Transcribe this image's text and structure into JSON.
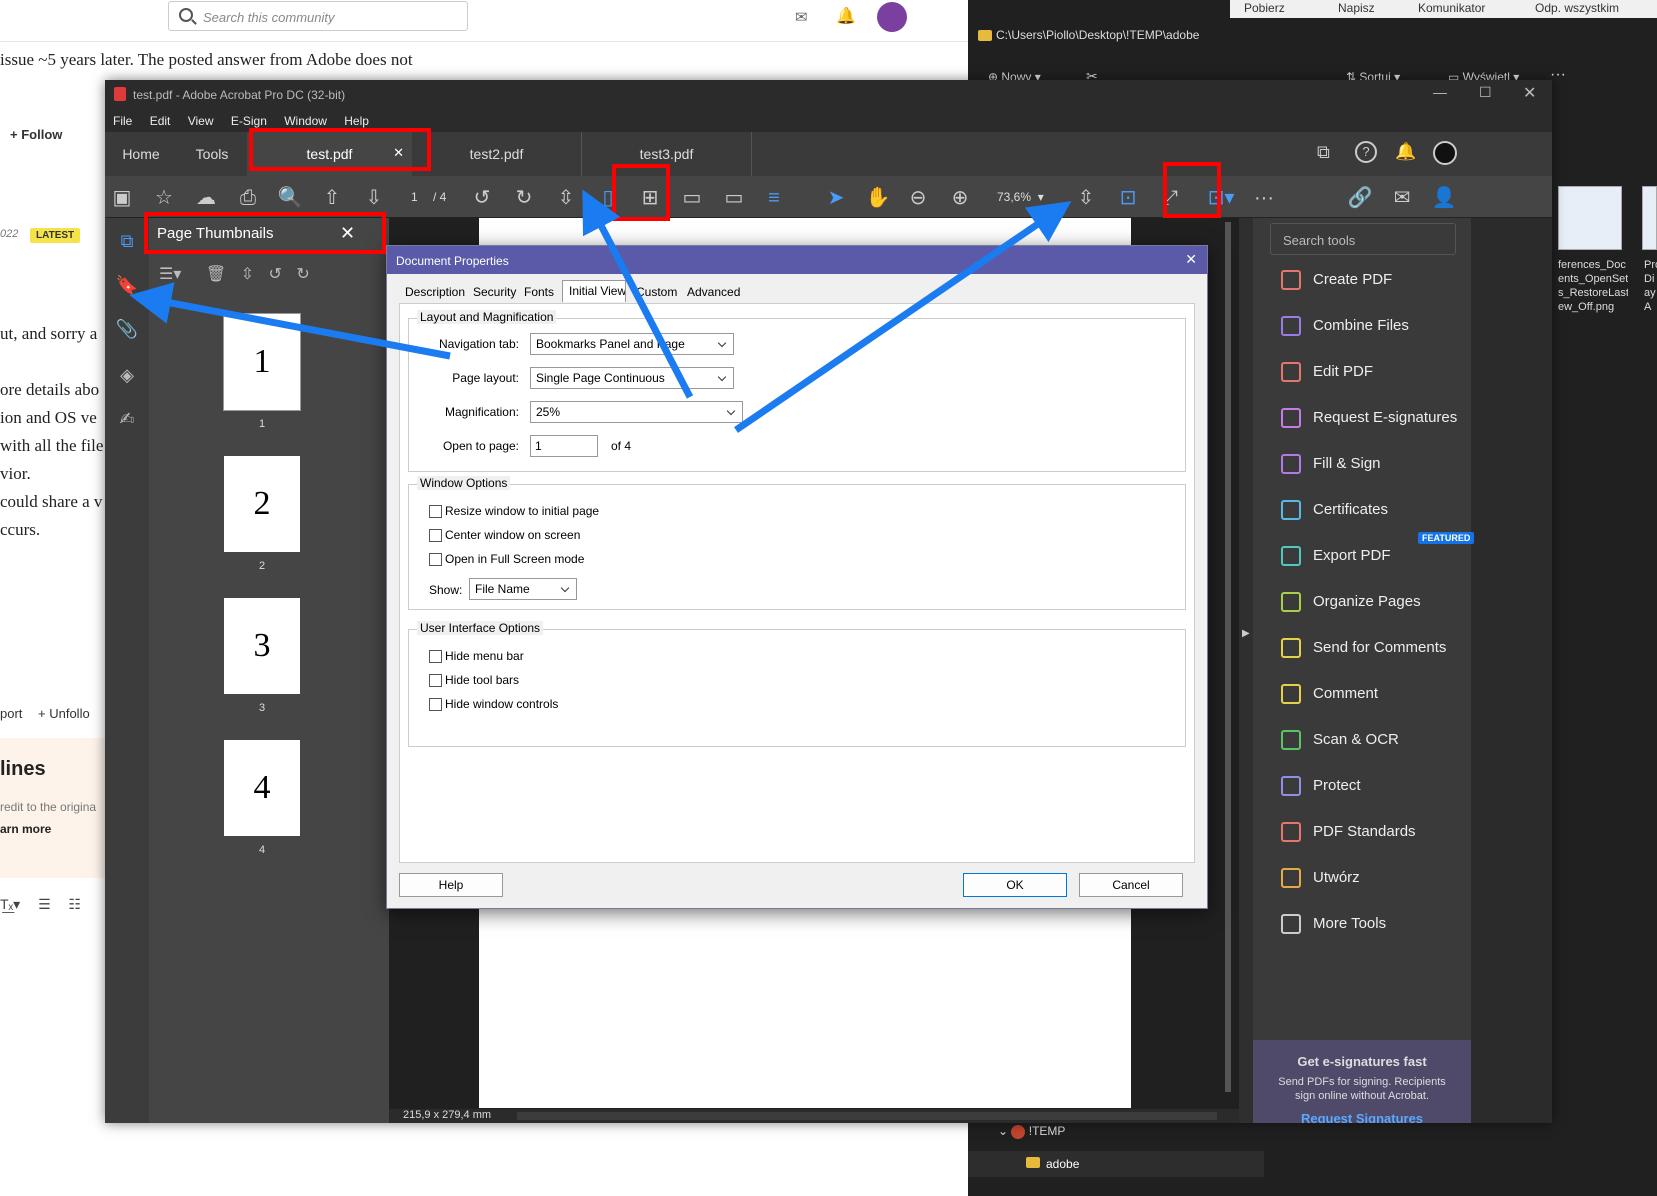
{
  "forum": {
    "search_placeholder": "Search this community",
    "line1": "issue ~5 years later. The posted answer from Adobe does not",
    "follow": "Follow",
    "date_fragment": "022",
    "latest_badge": "LATEST",
    "frag1": "ut, and sorry a",
    "frag2": "ore details abo",
    "frag3": "ion and OS ve",
    "frag4": "with all the file",
    "frag5": "vior.",
    "frag6": "could share a v",
    "frag7": "ccurs.",
    "report": "port",
    "unfollow": "Unfollo",
    "guidelines_title": "lines",
    "guidelines_text": "redit to the origina",
    "learn_more": "arn more"
  },
  "explorer": {
    "top_items": [
      "Pobierz",
      "Napisz",
      "Komunikator",
      "Odp. wszystkim"
    ],
    "path": "C:\\Users\\Piollo\\Desktop\\!TEMP\\adobe",
    "new": "Nowy",
    "sort": "Sortuj",
    "view": "Wyświetl",
    "file1_lines": [
      "ferences_Doc",
      "ents_OpenSet",
      "s_RestoreLast",
      "ew_Off.png"
    ],
    "file2_lines": [
      "Pro",
      "Di",
      "ay",
      "A"
    ],
    "tree_temp": "!TEMP",
    "tree_adobe": "adobe"
  },
  "acrobat": {
    "title": "test.pdf - Adobe Acrobat Pro DC (32-bit)",
    "menu": [
      "File",
      "Edit",
      "View",
      "E-Sign",
      "Window",
      "Help"
    ],
    "nav_home": "Home",
    "nav_tools": "Tools",
    "tabs": [
      "test.pdf",
      "test2.pdf",
      "test3.pdf"
    ],
    "page_current": "1",
    "page_total": "/ 4",
    "zoom": "73,6%",
    "thumb_panel_title": "Page Thumbnails",
    "thumbs": [
      "1",
      "2",
      "3",
      "4"
    ],
    "status_size": "215,9 x 279,4 mm",
    "search_tools": "Search tools",
    "right_tools": [
      {
        "label": "Create PDF",
        "icon": "create-pdf-icon",
        "color": "#e5766d"
      },
      {
        "label": "Combine Files",
        "icon": "combine-files-icon",
        "color": "#9b7be6"
      },
      {
        "label": "Edit PDF",
        "icon": "edit-pdf-icon",
        "color": "#e5766d"
      },
      {
        "label": "Request E-signatures",
        "icon": "request-esign-icon",
        "color": "#c77be6"
      },
      {
        "label": "Fill & Sign",
        "icon": "fill-sign-icon",
        "color": "#b07be6"
      },
      {
        "label": "Certificates",
        "icon": "certificates-icon",
        "color": "#5ab8e6"
      },
      {
        "label": "Export PDF",
        "icon": "export-pdf-icon",
        "color": "#4fc9c0"
      },
      {
        "label": "Organize Pages",
        "icon": "organize-pages-icon",
        "color": "#a6cf4a"
      },
      {
        "label": "Send for Comments",
        "icon": "send-comments-icon",
        "color": "#e6d24a"
      },
      {
        "label": "Comment",
        "icon": "comment-icon",
        "color": "#e6d24a"
      },
      {
        "label": "Scan & OCR",
        "icon": "scan-ocr-icon",
        "color": "#58c464"
      },
      {
        "label": "Protect",
        "icon": "protect-icon",
        "color": "#8f8fe6"
      },
      {
        "label": "PDF Standards",
        "icon": "pdf-standards-icon",
        "color": "#e5766d"
      },
      {
        "label": "Utwórz",
        "icon": "utworz-icon",
        "color": "#e6a94a"
      },
      {
        "label": "More Tools",
        "icon": "more-tools-icon",
        "color": "#cccccc"
      }
    ],
    "featured_badge": "FEATURED",
    "promo_title": "Get e-signatures fast",
    "promo_text": "Send PDFs for signing. Recipients sign online without Acrobat.",
    "promo_link": "Request Signatures"
  },
  "dialog": {
    "title": "Document Properties",
    "tabs": [
      "Description",
      "Security",
      "Fonts",
      "Initial View",
      "Custom",
      "Advanced"
    ],
    "layout_group": "Layout and Magnification",
    "nav_tab_label": "Navigation tab:",
    "nav_tab_value": "Bookmarks Panel and Page",
    "page_layout_label": "Page layout:",
    "page_layout_value": "Single Page Continuous",
    "magnification_label": "Magnification:",
    "magnification_value": "25%",
    "open_to_page_label": "Open to page:",
    "open_to_page_value": "1",
    "of_pages": "of 4",
    "window_group": "Window Options",
    "resize_window": "Resize window to initial page",
    "center_window": "Center window on screen",
    "full_screen": "Open in Full Screen mode",
    "show_label": "Show:",
    "show_value": "File Name",
    "ui_group": "User Interface Options",
    "hide_menu": "Hide menu bar",
    "hide_toolbars": "Hide tool bars",
    "hide_controls": "Hide window controls",
    "help_btn": "Help",
    "ok_btn": "OK",
    "cancel_btn": "Cancel"
  },
  "colors": {
    "highlight_red": "#ff0000",
    "arrow_blue": "#1b7bf0",
    "acrobat_blue": "#1473e6"
  }
}
